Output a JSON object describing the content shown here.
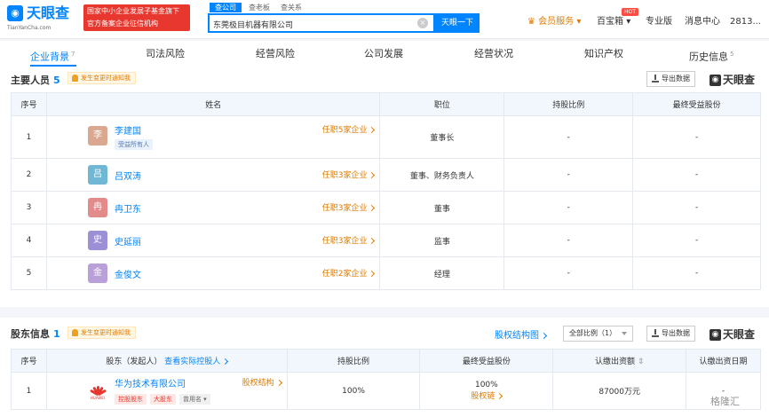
{
  "header": {
    "logo_text": "天眼查",
    "logo_url": "TianYanCha.com",
    "gov_badge_line1": "国家中小企业发展子基金旗下",
    "gov_badge_line2": "官方备案企业征信机构",
    "search_tabs": [
      "查公司",
      "查老板",
      "查关系"
    ],
    "search_value": "东莞极目机器有限公司",
    "search_button": "天眼一下",
    "vip_label": "会员服务",
    "baibaoxiang": "百宝箱",
    "hot_badge": "HOT",
    "pro_label": "专业版",
    "message_center": "消息中心",
    "user_name": "2813..."
  },
  "tabs": [
    {
      "label": "企业背景",
      "count": "7"
    },
    {
      "label": "司法风险",
      "count": ""
    },
    {
      "label": "经营风险",
      "count": ""
    },
    {
      "label": "公司发展",
      "count": ""
    },
    {
      "label": "经营状况",
      "count": ""
    },
    {
      "label": "知识产权",
      "count": ""
    },
    {
      "label": "历史信息",
      "count": "5"
    }
  ],
  "personnel": {
    "title": "主要人员",
    "count": "5",
    "notify_label": "发生变更时通知我",
    "export_label": "导出数据",
    "brand": "天眼查",
    "columns": [
      "序号",
      "姓名",
      "职位",
      "持股比例",
      "最终受益股份"
    ],
    "rows": [
      {
        "index": "1",
        "avatar": "李",
        "avatar_color": "#d9a88e",
        "name": "李建国",
        "tag": "受益所有人",
        "posts": "任职5家企业",
        "position": "董事长",
        "share": "-",
        "benefit": "-"
      },
      {
        "index": "2",
        "avatar": "吕",
        "avatar_color": "#6fb7d4",
        "name": "吕双涛",
        "tag": "",
        "posts": "任职3家企业",
        "position": "董事、财务负责人",
        "share": "-",
        "benefit": "-"
      },
      {
        "index": "3",
        "avatar": "冉",
        "avatar_color": "#e38a8a",
        "name": "冉卫东",
        "tag": "",
        "posts": "任职3家企业",
        "position": "董事",
        "share": "-",
        "benefit": "-"
      },
      {
        "index": "4",
        "avatar": "史",
        "avatar_color": "#9c8fd6",
        "name": "史延丽",
        "tag": "",
        "posts": "任职3家企业",
        "position": "监事",
        "share": "-",
        "benefit": "-"
      },
      {
        "index": "5",
        "avatar": "金",
        "avatar_color": "#b9a0d8",
        "name": "金俊文",
        "tag": "",
        "posts": "任职2家企业",
        "position": "经理",
        "share": "-",
        "benefit": "-"
      }
    ]
  },
  "shareholders": {
    "title": "股东信息",
    "count": "1",
    "notify_label": "发生变更时通知我",
    "equity_link": "股权结构图",
    "ratio_select": "全部比例（1）",
    "export_label": "导出数据",
    "brand": "天眼查",
    "col_index": "序号",
    "col_holder": "股东（发起人）",
    "col_holder_link": "查看实际控股人",
    "col_ratio": "持股比例",
    "col_benefit": "最终受益股份",
    "col_capital": "认缴出资额",
    "col_date": "认缴出资日期",
    "rows": [
      {
        "index": "1",
        "logo_text": "HUAWEI",
        "name": "华为技术有限公司",
        "structure_link": "股权结构",
        "tags": [
          "控股股东",
          "大股东"
        ],
        "alias_tag": "曾用名",
        "ratio": "100%",
        "benefit": "100%",
        "benefit_link": "股权链",
        "capital": "87000万元",
        "date": "-"
      }
    ]
  },
  "watermark": "格隆汇"
}
